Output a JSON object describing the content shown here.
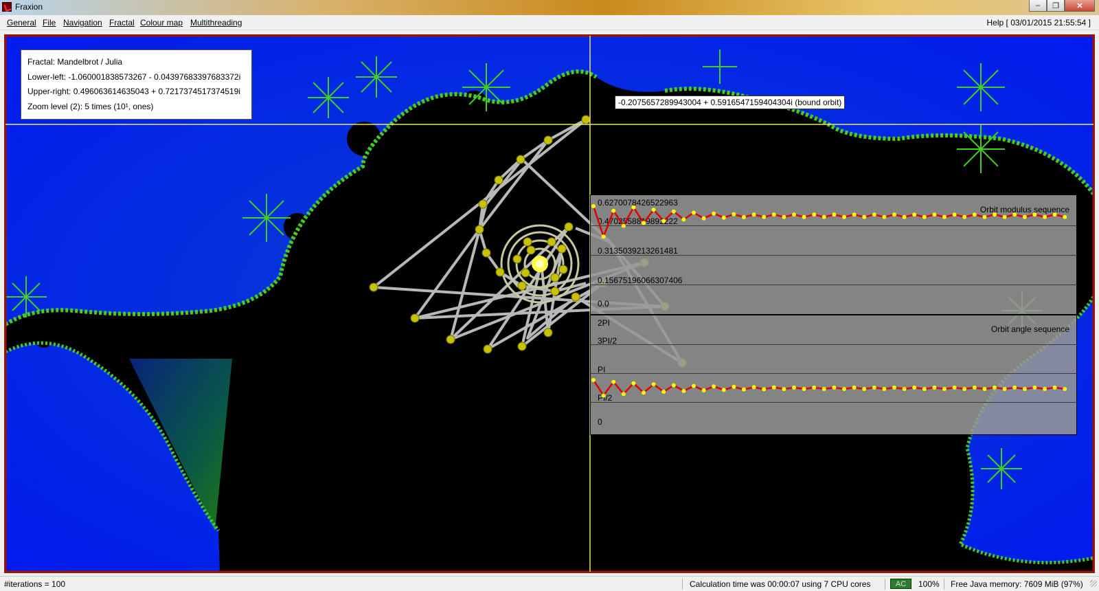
{
  "window": {
    "title": "Fraxion",
    "controls": [
      "minimize-icon",
      "maximize-icon",
      "close-icon"
    ]
  },
  "menu": {
    "items": [
      {
        "label": "General",
        "underline": "G"
      },
      {
        "label": "File",
        "underline": "F"
      },
      {
        "label": "Navigation",
        "underline": "N"
      },
      {
        "label": "Fractal",
        "underline": "F"
      },
      {
        "label": "Colour map",
        "underline": "C"
      },
      {
        "label": "Multithreading",
        "underline": "M"
      }
    ],
    "help": "Help",
    "datetime": "[ 03/01/2015 21:55:54 ]"
  },
  "info": {
    "fractal": "Fractal: Mandelbrot / Julia",
    "lower_left": "Lower-left: -1.060001838573267 - 0.043976833976833​72i",
    "upper_right": "Upper-right: 0.496063614635043 + 0.7217374517374519i",
    "zoom": "Zoom level (2): 5 times (10¹, ones)"
  },
  "cursor_tooltip": "-0.2075657289943004 + 0.5916547159404304i (bound orbit)",
  "modulus_panel": {
    "title": "Orbit modulus sequence",
    "labels": [
      "0.6270078426522963",
      "0.4702558819892222",
      "0.3135039213261481",
      "0.15675196066307406",
      "0.0"
    ]
  },
  "angle_panel": {
    "title": "Orbit angle sequence",
    "labels": [
      "2PI",
      "3PI/2",
      "PI",
      "PI/2",
      "0"
    ]
  },
  "status": {
    "iterations": "#iterations = 100",
    "calc_time": "Calculation time was 00:00:07 using 7 CPU cores",
    "ac": "AC",
    "battery": "100%",
    "memory": "Free Java memory: 7609 MiB (97%)"
  },
  "colors": {
    "set_interior": "#000000",
    "background_blue": "#0a1cf0",
    "fractal_edge": "#40e020",
    "orbit_line": "#b8b8b8",
    "orbit_point": "#c8c000",
    "sequence_line": "#e00000",
    "sequence_point": "#ffff00",
    "crosshair": "#e8e860"
  }
}
